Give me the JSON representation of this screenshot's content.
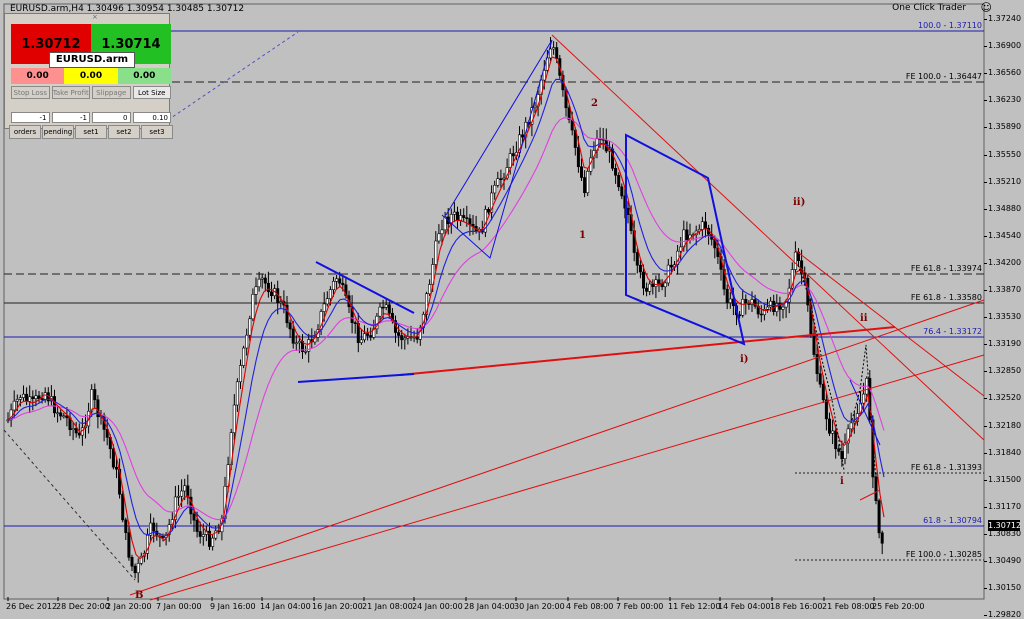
{
  "header": {
    "symbol_info": "EURUSD.arm,H4  1.30496 1.30954 1.30485 1.30712",
    "expert_name": "One Click Trader",
    "smile": "☺"
  },
  "trader": {
    "bid": "1.30712",
    "ask": "1.30714",
    "symbol": "EURUSD.arm 0.2",
    "value_1": "0.00",
    "value_2": "0.00",
    "value_3": "0.00",
    "buttons": [
      "Stop Loss",
      "Take Profit",
      "Slippage",
      "Lot Size"
    ],
    "inputs": [
      "-1",
      "-1",
      "0",
      "0.10"
    ],
    "tabs": [
      "orders",
      "pending",
      "set1",
      "set2",
      "set3"
    ]
  },
  "price_axis": [
    "1.37240",
    "1.36900",
    "1.36560",
    "1.36230",
    "1.35890",
    "1.35550",
    "1.35210",
    "1.34880",
    "1.34540",
    "1.34200",
    "1.33870",
    "1.33530",
    "1.33190",
    "1.32850",
    "1.32520",
    "1.32180",
    "1.31840",
    "1.31500",
    "1.31170",
    "1.30830",
    "1.30490",
    "1.30150",
    "1.29820"
  ],
  "current_price": "1.30712",
  "time_axis": [
    "26 Dec 2012",
    "28 Dec 20:00",
    "2 Jan 20:00",
    "7 Jan 00:00",
    "9 Jan 16:00",
    "14 Jan 04:00",
    "16 Jan 20:00",
    "21 Jan 08:00",
    "24 Jan 00:00",
    "28 Jan 04:00",
    "30 Jan 20:00",
    "4 Feb 08:00",
    "7 Feb 00:00",
    "11 Feb 12:00",
    "14 Feb 04:00",
    "18 Feb 16:00",
    "21 Feb 08:00",
    "25 Feb 20:00"
  ],
  "levels": [
    {
      "label": "100.0 - 1.37110",
      "color": "blue"
    },
    {
      "label": "FE 100.0 - 1.36447",
      "color": "black"
    },
    {
      "label": "FE 61.8 - 1.33974",
      "color": "black"
    },
    {
      "label": "FE 61.8 - 1.33580",
      "color": "black"
    },
    {
      "label": "76.4 - 1.33172",
      "color": "blue"
    },
    {
      "label": "FE 61.8 - 1.31393",
      "color": "black"
    },
    {
      "label": "61.8 - 1.30794",
      "color": "blue"
    },
    {
      "label": "FE 100.0 - 1.30285",
      "color": "black"
    }
  ],
  "waves": [
    "2",
    "1",
    "ii)",
    "i)",
    "ii",
    "i",
    "B"
  ],
  "colors": {
    "background": "#c0c0c0",
    "candle": "#000000",
    "ma_fast": "#e00000",
    "ma_mid": "#2020e0",
    "ma_slow": "#e040e0",
    "trend_red": "#e01010",
    "pattern_blue": "#1010e0"
  }
}
